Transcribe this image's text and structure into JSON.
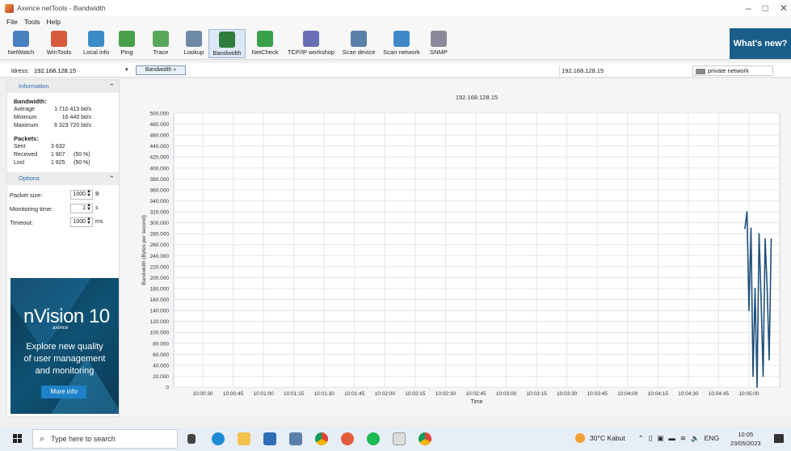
{
  "window": {
    "title": "Axence netTools - Bandwidth",
    "controls": [
      "–",
      "□",
      "✕"
    ]
  },
  "menu": {
    "items": [
      "File",
      "Tools",
      "Help"
    ]
  },
  "toolbar": {
    "tools": [
      {
        "label": "NetWatch",
        "icon": "netwatch-icon",
        "color": "#4a7fbf"
      },
      {
        "label": "WinTools",
        "icon": "wintools-icon",
        "color": "#d65a3b"
      },
      {
        "label": "Local info",
        "icon": "local-info-icon",
        "color": "#3b8bc6"
      },
      {
        "label": "Ping",
        "icon": "ping-icon",
        "color": "#4aa04a"
      },
      {
        "label": "Trace",
        "icon": "trace-icon",
        "color": "#58a85a"
      },
      {
        "label": "Lookup",
        "icon": "lookup-icon",
        "color": "#6e88a8"
      },
      {
        "label": "Bandwidth",
        "icon": "bandwidth-icon",
        "color": "#2f7d3a"
      },
      {
        "label": "NetCheck",
        "icon": "netcheck-icon",
        "color": "#3aa14a"
      },
      {
        "label": "TCP/IP workshop",
        "icon": "tcpip-workshop-icon",
        "color": "#6a6fb5"
      },
      {
        "label": "Scan device",
        "icon": "scan-device-icon",
        "color": "#5a7fa8"
      },
      {
        "label": "Scan network",
        "icon": "scan-network-icon",
        "color": "#3f89c8"
      },
      {
        "label": "SNMP",
        "icon": "snmp-icon",
        "color": "#8a8a9a"
      }
    ],
    "whats_new": "What's new?"
  },
  "address": {
    "label": "ldress:",
    "value": "192.168.128.15",
    "button": "Bandwidth »",
    "host_display": "192.168.128.15",
    "network_type": "private network"
  },
  "info": {
    "header": "Information",
    "bandwidth_title": "Bandwidth:",
    "bandwidth": [
      {
        "k": "Average",
        "v": "1 710 413 bit/s"
      },
      {
        "k": "Minimum",
        "v": "16 440 bit/s"
      },
      {
        "k": "Maximum",
        "v": "6 323 720 bit/s"
      }
    ],
    "packets_title": "Packets:",
    "packets": [
      {
        "k": "Sent",
        "v": "3 632",
        "p": ""
      },
      {
        "k": "Received",
        "v": "1 807",
        "p": "(50 %)"
      },
      {
        "k": "Lost",
        "v": "1 825",
        "p": "(50 %)"
      }
    ]
  },
  "options": {
    "header": "Options",
    "rows": [
      {
        "label": "Packet size:",
        "value": "1000",
        "unit": "B"
      },
      {
        "label": "Monitoring time:",
        "value": "1",
        "unit": "s"
      },
      {
        "label": "Timeout:",
        "value": "1000",
        "unit": "ms"
      }
    ]
  },
  "ad": {
    "logo": "nVision 10",
    "brand": "axence",
    "tagline": [
      "Explore new quality",
      "of user management",
      "and monitoring"
    ],
    "button": "More info"
  },
  "chart_data": {
    "type": "line",
    "title": "192.168.128.15",
    "xlabel": "Time",
    "ylabel": "Bandwidth (Bytes per second)",
    "ylim": [
      0,
      500000
    ],
    "yticks": [
      "0",
      "20.000",
      "40.000",
      "60.000",
      "80.000",
      "100.000",
      "120.000",
      "140.000",
      "160.000",
      "180.000",
      "200.000",
      "220.000",
      "240.000",
      "260.000",
      "280.000",
      "300.000",
      "320.000",
      "340.000",
      "360.000",
      "380.000",
      "400.000",
      "420.000",
      "440.000",
      "460.000",
      "480.000",
      "500.000"
    ],
    "xticks": [
      "10:00:30",
      "10:00:45",
      "10:01:00",
      "10:01:15",
      "10:01:30",
      "10:01:45",
      "10:02:00",
      "10:02:15",
      "10:02:30",
      "10:02:45",
      "10:03:00",
      "10:03:15",
      "10:03:30",
      "10:03:45",
      "10:04:00",
      "10:04:15",
      "10:04:30",
      "10:04:45",
      "10:05:00"
    ],
    "grid": true,
    "series": [
      {
        "color": "#1f4f7a",
        "x": [
          "10:04:58",
          "10:04:59",
          "10:05:00",
          "10:05:01",
          "10:05:02",
          "10:05:03",
          "10:05:04",
          "10:05:05",
          "10:05:06",
          "10:05:07",
          "10:05:08",
          "10:05:09",
          "10:05:10",
          "10:05:11"
        ],
        "values": [
          290000,
          320000,
          140000,
          290000,
          20000,
          180000,
          0,
          280000,
          160000,
          20000,
          270000,
          180000,
          50000,
          270000
        ]
      }
    ]
  },
  "taskbar": {
    "search_placeholder": "Type here to search",
    "weather": "30°C Kabut",
    "lang": "ENG",
    "time": "10:05",
    "date": "23/05/2023"
  }
}
